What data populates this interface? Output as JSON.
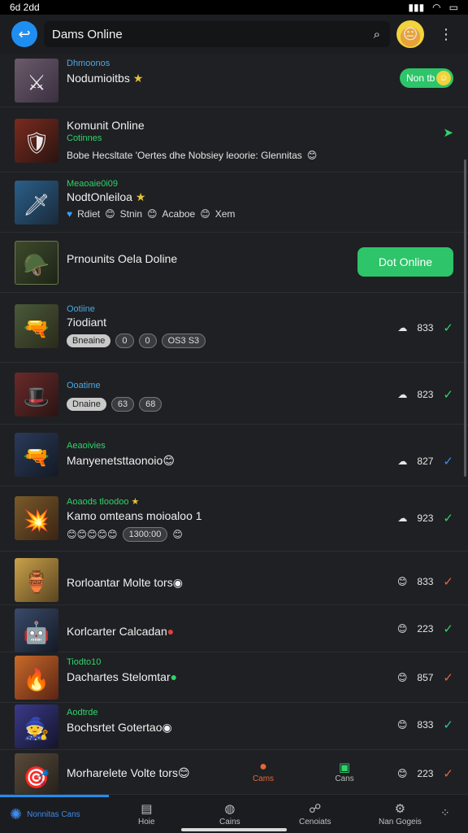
{
  "status": {
    "time": "6d 2dd",
    "icons": [
      "signal-icon",
      "wifi-icon",
      "battery-icon"
    ]
  },
  "header": {
    "search_value": "Dams Online"
  },
  "rows": [
    {
      "sub": "Dhmoonos",
      "title": "Nodumioitbs",
      "extra": "",
      "badge": "Non tb",
      "color_sub": "#4aa8e6"
    },
    {
      "sub": "Cotinnes",
      "title": "Komunit Online",
      "extra": "Bobe Hecsltate 'Oertes dhe Nobsiey leoorie: Glennitas",
      "color_sub": "#2dd46b"
    },
    {
      "sub": "Meaoaie0i09",
      "title": "NodtOnleiloa",
      "chips": [
        "Rdiet",
        "Stnin",
        "Acaboe",
        "Xem"
      ],
      "color_sub": "#2dd46b"
    },
    {
      "title": "Prnounits Oela Doline",
      "button": "Dot Online"
    },
    {
      "sub": "Ootiine",
      "title": "7iodiant",
      "pills": [
        "Bneaine",
        "0",
        "0",
        "OS3 S3"
      ],
      "count": "833",
      "color_sub": "#4aa8e6"
    },
    {
      "sub": "Ooatime",
      "title": "",
      "pills": [
        "Dnaine",
        "63",
        "68"
      ],
      "count": "823",
      "color_sub": "#4aa8e6"
    },
    {
      "sub": "Aeaoivies",
      "title": "Manyenetsttaonoio",
      "count": "827",
      "color_sub": "#2dd46b"
    },
    {
      "sub": "Aoaods tloodoo",
      "title": "Kamo omteans moioaloo 1",
      "time": "1300:00",
      "count": "923",
      "color_sub": "#2dd46b"
    },
    {
      "title": "Rorloantar Molte tors",
      "count": "833"
    },
    {
      "title": "Korlcarter Calcadan",
      "count": "223"
    },
    {
      "sub": "Tiodto10",
      "title": "Dachartes Stelomtar",
      "count": "857",
      "color_sub": "#2dd46b"
    },
    {
      "sub": "Aodtrde",
      "title": "Bochsrtet Gotertao",
      "count": "833",
      "color_sub": "#2dd46b"
    },
    {
      "title": "Morharelete Volte tors",
      "count": "223"
    }
  ],
  "midtabs": [
    {
      "label": "Cams"
    },
    {
      "label": "Cans"
    }
  ],
  "nav": [
    {
      "label": "Nonnitas Cans",
      "icon": "community-icon"
    },
    {
      "label": "Hoie",
      "icon": "home-icon"
    },
    {
      "label": "Cains",
      "icon": "games-icon"
    },
    {
      "label": "Cenoiats",
      "icon": "contacts-icon"
    },
    {
      "label": "Nan Gogeis",
      "icon": "settings-icon"
    }
  ]
}
